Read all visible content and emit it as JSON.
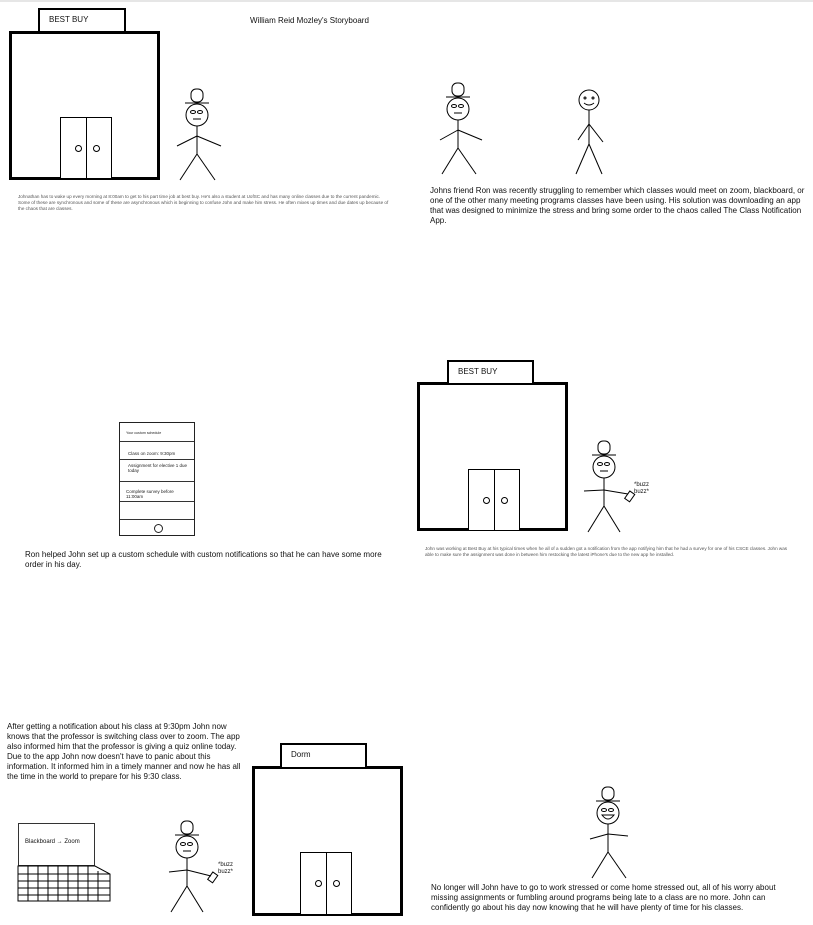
{
  "page": {
    "title": "William Reid Mozley's Storyboard"
  },
  "panels": {
    "p1": {
      "sign": "BEST BUY",
      "caption": "Johnathan has to wake up every morning at 8:00am to get to his part time job at best buy. He's also a student at UofSC and has many online classes due to the current pandemic. Some of these are synchronous and some of these are asynchronous which is beginning to confuse John and make him stress. He often mixes up times and due dates up because of the chaos that are classes."
    },
    "p2": {
      "caption": "Johns friend Ron was recently struggling to remember which classes would meet on zoom, blackboard, or one of the other many meeting programs classes have been using. His solution was downloading an app that was designed to minimize the stress and bring some order to the chaos called The Class Notification App."
    },
    "p3": {
      "phone": {
        "header": "Your custom schedule",
        "item1": "Class on zoom: 9:30pm",
        "item2": "Assignment for elective 1 due today",
        "item3": "Complete survey before 11:00am"
      },
      "caption": "Ron helped John set up a custom schedule with custom notifications so that he can have some more order in his day."
    },
    "p4": {
      "sign": "BEST BUY",
      "buzz": "*buzz buzz*",
      "caption": "John was working at Best Buy at his typical times when he all of a sudden got a notification from the app notifying him that he had a survey for one of his CSCE classes. John was able to make sure the assignment was done in between him restocking the latest iPhone's due to the new app he installed."
    },
    "p5": {
      "caption": "After getting a notification about his class at 9:30pm John now knows that the professor is switching class over to zoom. The app also informed him that the professor is giving a quiz online today. Due to the app John now doesn't have to panic about this information. It informed him in a timely manner and now he has all the time in the world to prepare for his 9:30 class.",
      "laptop_screen": "Blackboard → Zoom",
      "buzz": "*buzz buzz*",
      "sign": "Dorm"
    },
    "p6": {
      "caption": "No longer will John have to go to work stressed or come home stressed out, all of his worry about missing assignments or fumbling around programs being late to a class are no more. John can confidently go about his day now knowing that he will have plenty of time for his classes."
    }
  }
}
